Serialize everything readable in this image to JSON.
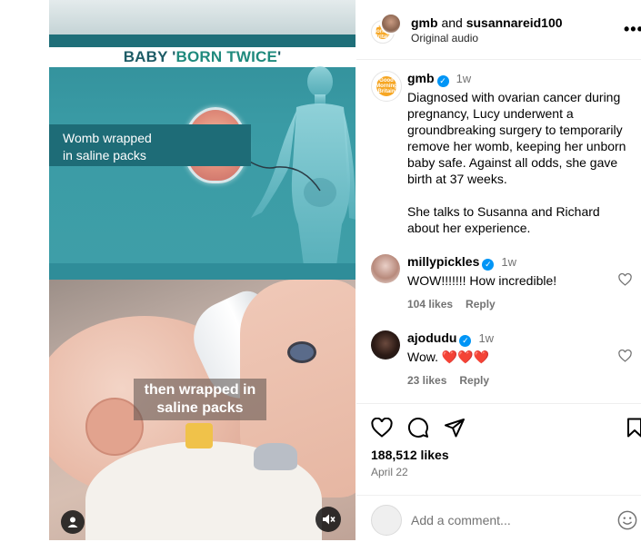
{
  "media": {
    "headline_prefix": "BABY '",
    "headline_emphasis": "BORN TWICE",
    "headline_suffix": "'",
    "caption_top_line1": "Womb wrapped",
    "caption_top_line2": "in saline packs",
    "caption_bottom_line1": "then wrapped in",
    "caption_bottom_line2": "saline packs",
    "user_icon": "user-tag-icon",
    "mute_icon": "speaker-muted-icon"
  },
  "header": {
    "account1": "gmb",
    "joiner": "and",
    "account2": "susannareid100",
    "audio": "Original audio",
    "more_icon": "more-options-icon",
    "more_glyph": "•••"
  },
  "caption": {
    "username": "gmb",
    "time": "1w",
    "paragraph1": "Diagnosed with ovarian cancer during pregnancy, Lucy underwent a groundbreaking surgery to temporarily remove her womb, keeping her unborn baby safe. Against all odds, she gave birth at 37 weeks.",
    "paragraph2": "She talks to Susanna and Richard about her experience."
  },
  "comments": [
    {
      "username": "millypickles",
      "time": "1w",
      "text": "WOW!!!!!!! How incredible!",
      "likes": "104 likes",
      "reply": "Reply"
    },
    {
      "username": "ajodudu",
      "time": "1w",
      "text": "Wow. ❤️❤️❤️",
      "likes": "23 likes",
      "reply": "Reply"
    }
  ],
  "actions": {
    "likes": "188,512 likes",
    "date": "April 22",
    "icons": [
      "heart-icon",
      "comment-icon",
      "share-icon",
      "bookmark-icon"
    ]
  },
  "add_comment": {
    "placeholder": "Add a comment...",
    "emoji_icon": "emoji-icon"
  },
  "avatar_badge_text": "Good Morning Britain",
  "colors": {
    "verified": "#0095f6",
    "muted_text": "#737373",
    "teal_graphic": "#2e8a95"
  }
}
